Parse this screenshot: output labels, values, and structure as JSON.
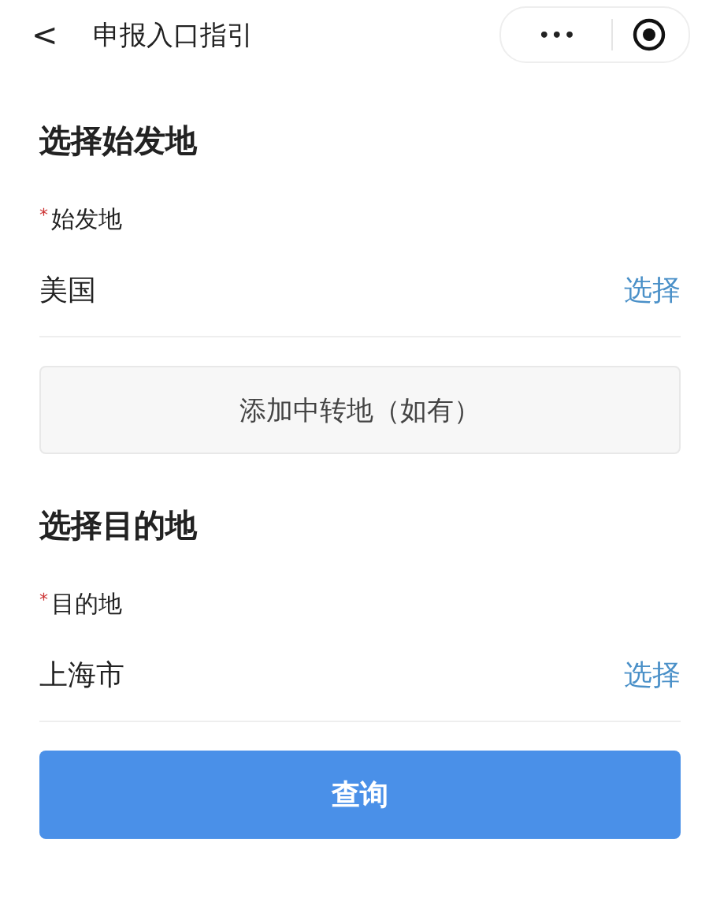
{
  "nav_bar": {
    "back": "<",
    "title": "申报入口指引",
    "more": "•••"
  },
  "sections": [
    {
      "heading": "选择始发地",
      "field": {
        "required_mark": "*",
        "label": "始发地",
        "value": "美国",
        "action": "选择"
      },
      "extra_button": "添加中转地（如有）"
    },
    {
      "heading": "选择目的地",
      "field": {
        "required_mark": "*",
        "label": "目的地",
        "value": "上海市",
        "action": "选择"
      }
    }
  ],
  "submit_button": "查询"
}
